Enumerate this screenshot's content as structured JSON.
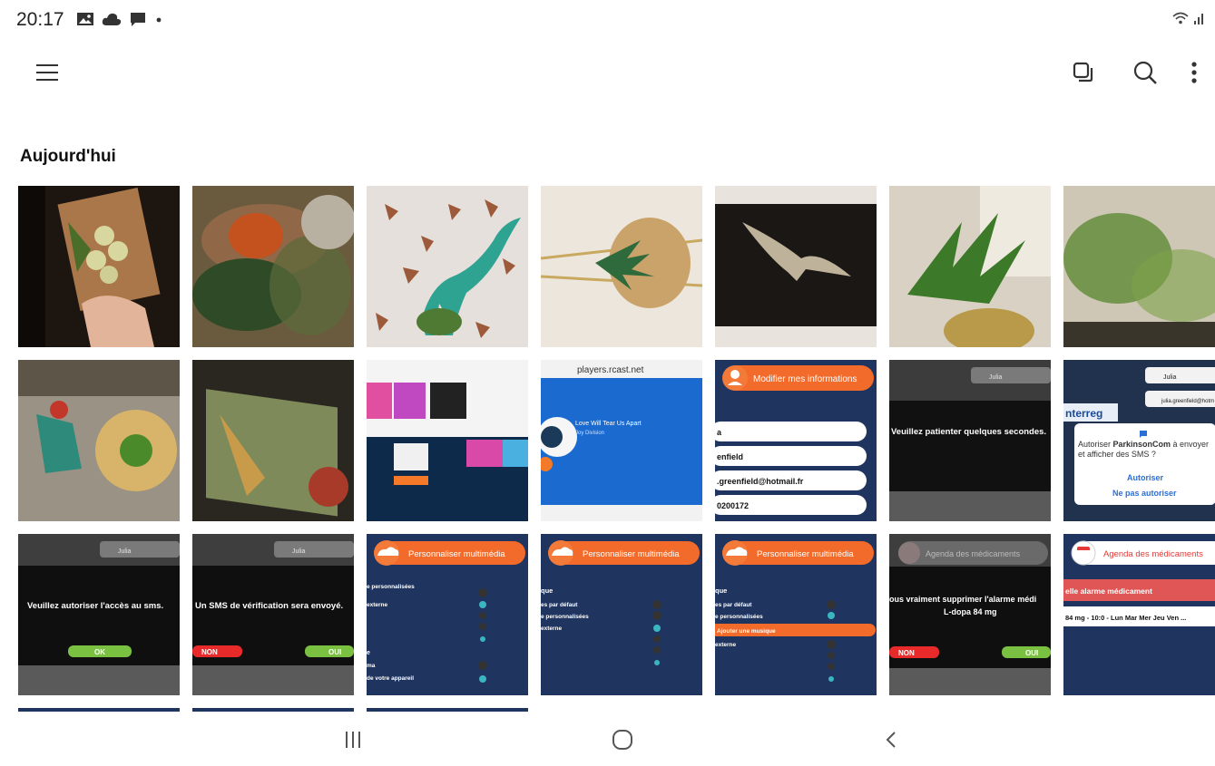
{
  "status_bar": {
    "time": "20:17",
    "notification_icons": [
      "gallery-icon",
      "cloud-icon",
      "message-icon",
      "dot-icon"
    ],
    "system_icons": [
      "wifi-icon",
      "signal-icon"
    ]
  },
  "toolbar": {
    "menu_icon": "hamburger-icon",
    "actions": [
      "multi-window-icon",
      "search-icon",
      "more-options-icon"
    ]
  },
  "section": {
    "title": "Aujourd'hui"
  },
  "grid": {
    "row1": [
      "photo-kitchen",
      "photo-blurry-plant",
      "photo-dinosaur",
      "photo-hanging-plant",
      "photo-eagle",
      "photo-plant-window",
      "photo-blurry-plant-2"
    ],
    "row2": {
      "photo_bottle": "photo-bottle",
      "photo_window": "photo-window",
      "screenshot_apps": "screenshot-apps",
      "rcast": {
        "url": "players.rcast.net",
        "title": "Love Will Tear Us Apart",
        "artist": "Joy Division"
      },
      "modifier": {
        "header": "Modifier mes informations",
        "fields": [
          "a",
          "enfield",
          ".greenfield@hotmail.fr",
          "0200172"
        ]
      },
      "patienter": {
        "user": "Julia",
        "message": "Veuillez patienter quelques secondes."
      },
      "sms_dialog": {
        "user": "Julia",
        "email": "julia.greenfield@hotm",
        "logo": "nterreg",
        "prompt_before": "Autoriser ",
        "app_name": "ParkinsonCom",
        "prompt_after": " à envoyer et afficher des SMS ?",
        "allow": "Autoriser",
        "deny": "Ne pas autoriser"
      }
    },
    "row3": {
      "sms_access": {
        "user": "Julia",
        "message": "Veuillez autoriser l'accès au sms.",
        "ok": "OK"
      },
      "sms_verify": {
        "user": "Julia",
        "message": "Un SMS de vérification sera envoyé.",
        "non": "NON",
        "oui": "OUI"
      },
      "perso1": {
        "header": "Personnaliser multimédia",
        "rows": [
          "e personnalisées",
          "externe",
          "",
          "",
          "e",
          "ma",
          "de votre appareil"
        ]
      },
      "perso2": {
        "header": "Personnaliser multimédia",
        "rows": [
          "que",
          "es par défaut",
          "e personnalisées",
          "externe"
        ]
      },
      "perso3": {
        "header": "Personnaliser multimédia",
        "rows": [
          "que",
          "es par défaut",
          "e personnalisées",
          "Ajouter une musique",
          "externe"
        ]
      },
      "agenda_delete": {
        "header": "Agenda des médicaments",
        "message_line1": "ous vraiment supprimer l'alarme médi",
        "message_line2": "L-dopa 84 mg",
        "non": "NON",
        "oui": "OUI"
      },
      "agenda": {
        "header": "Agenda des médicaments",
        "banner": "elle alarme médicament",
        "entry": "84 mg - 10:0 - Lun Mar Mer Jeu Ven ..."
      }
    }
  },
  "nav_bar": [
    "recents-button",
    "home-button",
    "back-button"
  ]
}
